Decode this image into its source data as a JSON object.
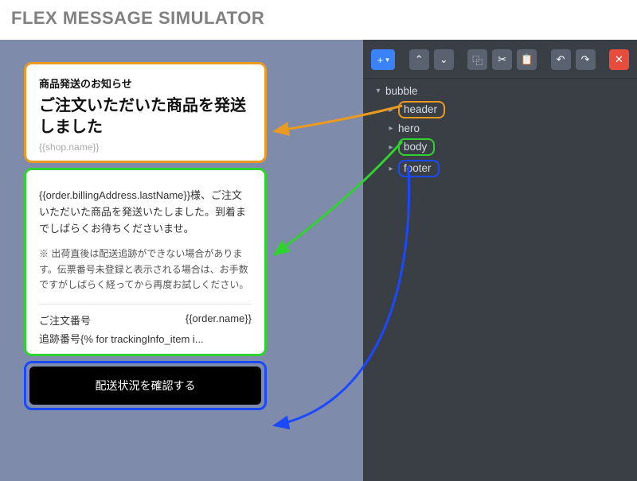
{
  "app": {
    "title": "FLEX MESSAGE SIMULATOR"
  },
  "highlight_colors": {
    "header": "#ea9a20",
    "body": "#2fd22f",
    "footer": "#1a49ff"
  },
  "bubble": {
    "header": {
      "subtitle": "商品発送のお知らせ",
      "title": "ご注文いただいた商品を発送しました",
      "shop_placeholder": "{{shop.name}}"
    },
    "body": {
      "paragraph": "{{order.billingAddress.lastName}}様、ご注文いただいた商品を発送いたしました。到着までしばらくお待ちくださいませ。",
      "note": "※ 出荷直後は配送追跡ができない場合があります。伝票番号未登録と表示される場合は、お手数ですがしばらく経ってから再度お試しください。",
      "order_label": "ご注文番号",
      "order_value": "{{order.name}}",
      "tracking_line": "追跡番号{% for trackingInfo_item i..."
    },
    "footer": {
      "button_label": "配送状況を確認する"
    }
  },
  "toolbar": {
    "add": "+",
    "add_caret": "▾",
    "up": "⌃",
    "down": "⌄",
    "copy": "⿻",
    "cut": "✂",
    "paste": "📋",
    "undo": "↶",
    "redo": "↷",
    "delete": "✕"
  },
  "tree": {
    "root": "bubble",
    "items": [
      {
        "label": "header",
        "highlight": "orange"
      },
      {
        "label": "hero",
        "highlight": null
      },
      {
        "label": "body",
        "highlight": "green"
      },
      {
        "label": "footer",
        "highlight": "blue"
      }
    ]
  }
}
